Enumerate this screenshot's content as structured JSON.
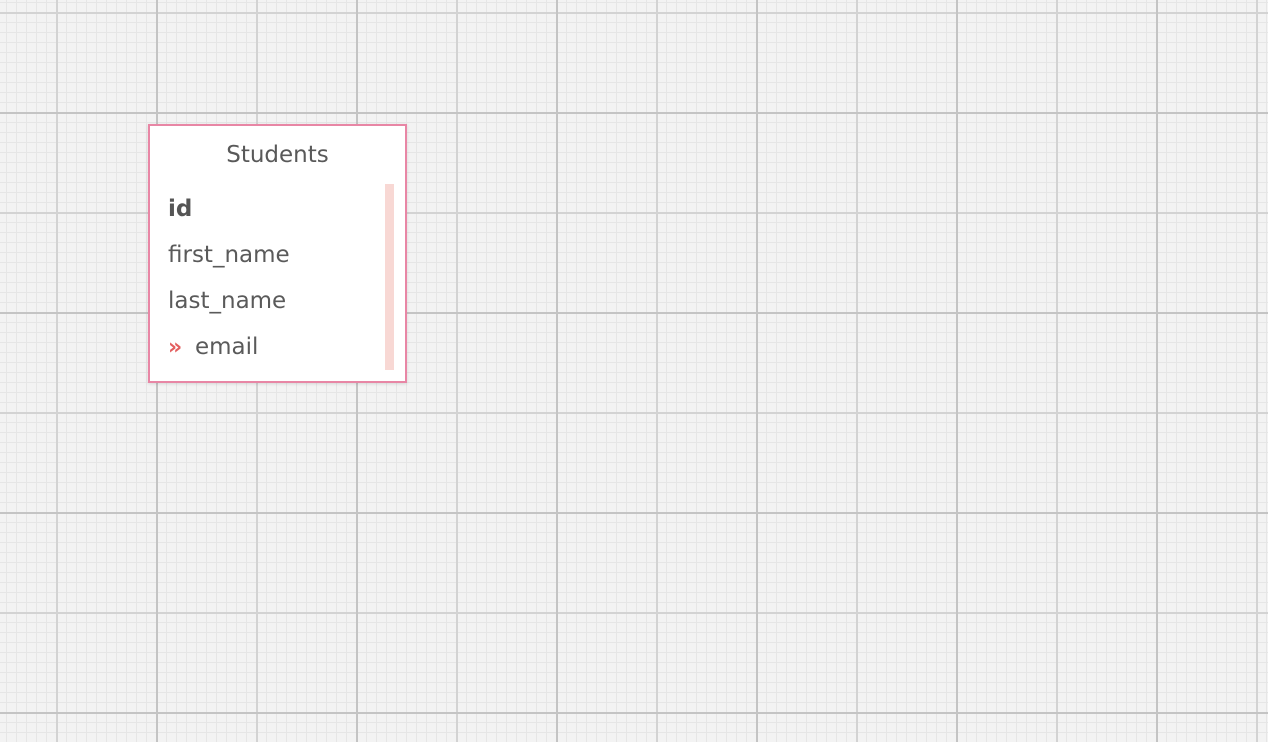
{
  "entity": {
    "title": "Students",
    "fields": [
      {
        "name": "id",
        "primary_key": true
      },
      {
        "name": "first_name"
      },
      {
        "name": "last_name"
      },
      {
        "name": "email",
        "icon": "double-chevron-icon"
      }
    ]
  },
  "colors": {
    "canvas_background": "#f3f3f3",
    "entity_border": "#e886a5",
    "foreign_key_icon": "#e35f5f",
    "scrollbar": "#f8d8d4"
  },
  "icons": {
    "email_marker": "»"
  }
}
